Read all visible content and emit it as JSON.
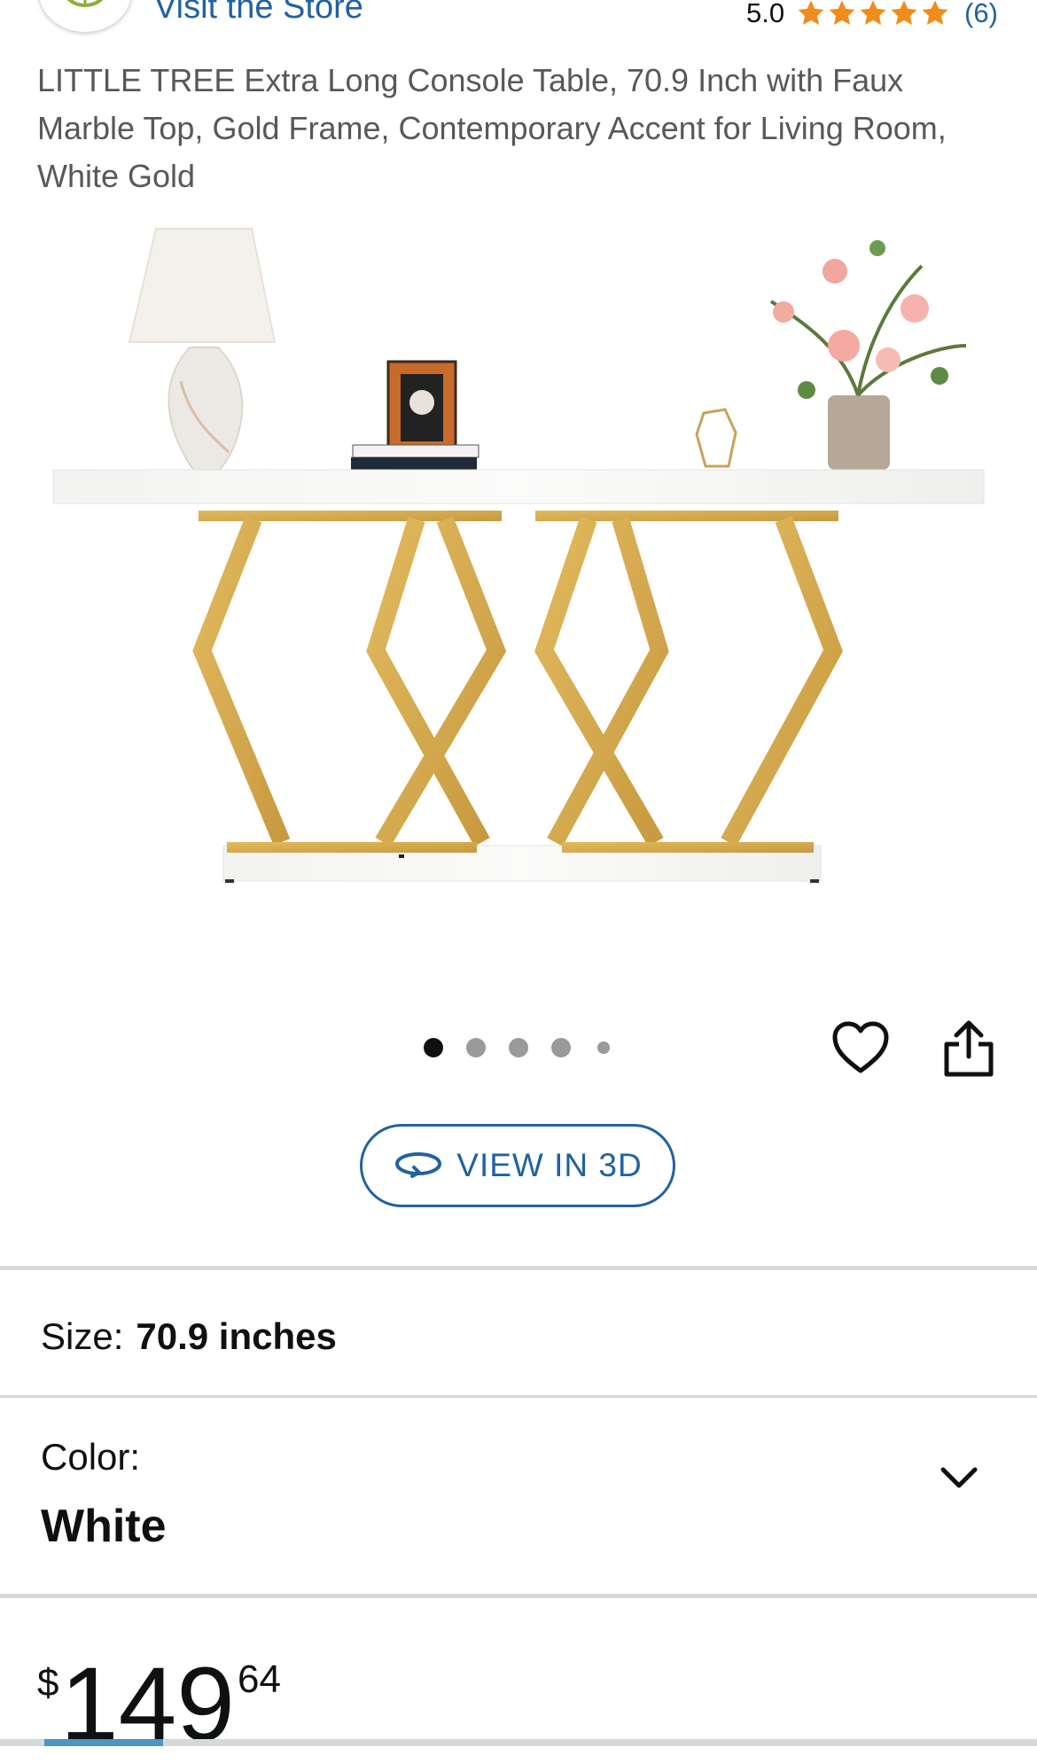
{
  "store": {
    "link_label": "Visit the Store"
  },
  "rating": {
    "value": "5.0",
    "stars_filled": 5,
    "count_label": "(6)",
    "star_color": "#f08c1c"
  },
  "product": {
    "title": "LITTLE TREE Extra Long Console Table, 70.9 Inch with Faux Marble Top, Gold Frame, Contemporary Accent for Living Room, White Gold"
  },
  "carousel": {
    "total_images": 5,
    "active_index": 0
  },
  "actions": {
    "wishlist_icon": "heart-icon",
    "share_icon": "share-icon",
    "view3d_label": "VIEW IN 3D"
  },
  "variations": {
    "size_label": "Size:",
    "size_value": "70.9 inches",
    "color_label": "Color:",
    "color_value": "White"
  },
  "price": {
    "symbol": "$",
    "whole": "149",
    "fraction": "64"
  },
  "colors": {
    "link": "#2162a1",
    "divider": "#d5d9d9",
    "gold": "#d4a44a"
  }
}
